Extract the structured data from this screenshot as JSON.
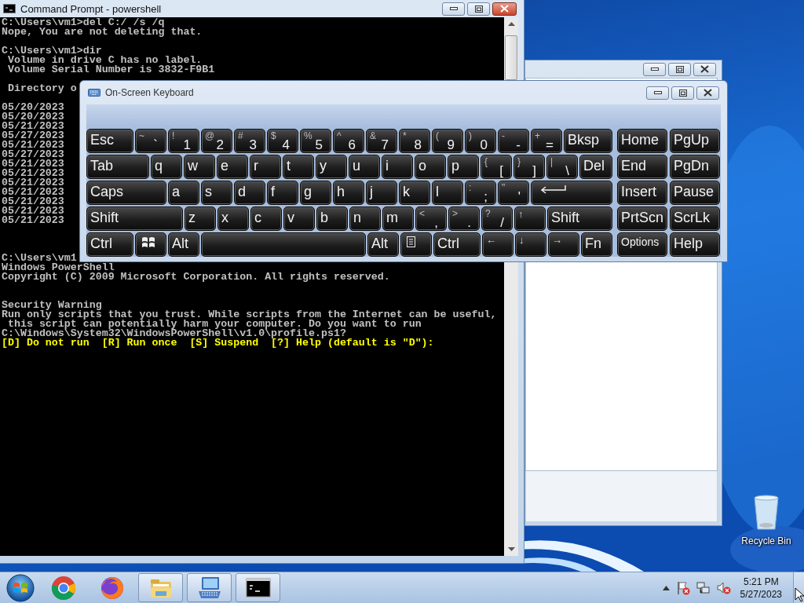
{
  "console_window": {
    "title": "Command Prompt - powershell",
    "blocks": [
      {
        "lines": [
          {
            "text": "C:\\Users\\vm1>del C:/ /s /q",
            "kind": "output"
          },
          {
            "text": "Nope, You are not deleting that.",
            "kind": "output"
          }
        ]
      },
      {
        "lines": [
          {
            "text": "C:\\Users\\vm1>dir",
            "kind": "output"
          },
          {
            "text": " Volume in drive C has no label.",
            "kind": "output"
          },
          {
            "text": " Volume Serial Number is 3832-F9B1",
            "kind": "output"
          }
        ]
      },
      {
        "lines": [
          {
            "text": " Directory o",
            "kind": "output"
          }
        ]
      },
      {
        "lines": [
          {
            "text": "05/20/2023",
            "kind": "output"
          },
          {
            "text": "05/20/2023",
            "kind": "output"
          },
          {
            "text": "05/21/2023",
            "kind": "output"
          },
          {
            "text": "05/27/2023",
            "kind": "output"
          },
          {
            "text": "05/21/2023",
            "kind": "output"
          },
          {
            "text": "05/27/2023",
            "kind": "output"
          },
          {
            "text": "05/21/2023",
            "kind": "output"
          },
          {
            "text": "05/21/2023",
            "kind": "output"
          },
          {
            "text": "05/21/2023",
            "kind": "output"
          },
          {
            "text": "05/21/2023",
            "kind": "output"
          },
          {
            "text": "05/21/2023",
            "kind": "output"
          },
          {
            "text": "05/21/2023",
            "kind": "output"
          },
          {
            "text": "05/21/2023",
            "kind": "output"
          }
        ]
      },
      {
        "lines": [
          {
            "text": "C:\\Users\\vm1",
            "kind": "output"
          },
          {
            "text": "Windows PowerShell",
            "kind": "output"
          },
          {
            "text": "Copyright (C) 2009 Microsoft Corporation. All rights reserved.",
            "kind": "output"
          }
        ]
      },
      {
        "lines": [
          {
            "text": "Security Warning",
            "kind": "output"
          },
          {
            "text": "Run only scripts that you trust. While scripts from the Internet can be useful,",
            "kind": "output"
          },
          {
            "text": " this script can potentially harm your computer. Do you want to run",
            "kind": "output"
          },
          {
            "text": "C:\\Windows\\System32\\WindowsPowerShell\\v1.0\\profile.ps1?",
            "kind": "output"
          },
          {
            "text": "[D] Do not run  [R] Run once  [S] Suspend  [?] Help (default is \"D\"):",
            "kind": "prompt"
          }
        ]
      }
    ]
  },
  "keyboard": {
    "title": "On-Screen Keyboard",
    "rows": [
      {
        "keys": [
          {
            "kind": "label",
            "label": "Esc"
          },
          {
            "kind": "dual",
            "shift": "~",
            "main": "`"
          },
          {
            "kind": "dual",
            "shift": "!",
            "main": "1"
          },
          {
            "kind": "dual",
            "shift": "@",
            "main": "2"
          },
          {
            "kind": "dual",
            "shift": "#",
            "main": "3"
          },
          {
            "kind": "dual",
            "shift": "$",
            "main": "4"
          },
          {
            "kind": "dual",
            "shift": "%",
            "main": "5"
          },
          {
            "kind": "dual",
            "shift": "^",
            "main": "6"
          },
          {
            "kind": "dual",
            "shift": "&",
            "main": "7"
          },
          {
            "kind": "dual",
            "shift": "*",
            "main": "8"
          },
          {
            "kind": "dual",
            "shift": "(",
            "main": "9"
          },
          {
            "kind": "dual",
            "shift": ")",
            "main": "0"
          },
          {
            "kind": "dual",
            "shift": "-",
            "main": "-"
          },
          {
            "kind": "dual",
            "shift": "+",
            "main": "="
          },
          {
            "kind": "label",
            "label": "Bksp"
          }
        ]
      },
      {
        "keys": [
          {
            "kind": "label",
            "label": "Tab"
          },
          {
            "kind": "label",
            "label": "q"
          },
          {
            "kind": "label",
            "label": "w"
          },
          {
            "kind": "label",
            "label": "e"
          },
          {
            "kind": "label",
            "label": "r"
          },
          {
            "kind": "label",
            "label": "t"
          },
          {
            "kind": "label",
            "label": "y"
          },
          {
            "kind": "label",
            "label": "u"
          },
          {
            "kind": "label",
            "label": "i"
          },
          {
            "kind": "label",
            "label": "o"
          },
          {
            "kind": "label",
            "label": "p"
          },
          {
            "kind": "dual",
            "shift": "{",
            "main": "["
          },
          {
            "kind": "dual",
            "shift": "}",
            "main": "]"
          },
          {
            "kind": "dual",
            "shift": "|",
            "main": "\\"
          },
          {
            "kind": "label",
            "label": "Del"
          }
        ]
      },
      {
        "keys": [
          {
            "kind": "label",
            "label": "Caps"
          },
          {
            "kind": "label",
            "label": "a"
          },
          {
            "kind": "label",
            "label": "s"
          },
          {
            "kind": "label",
            "label": "d"
          },
          {
            "kind": "label",
            "label": "f"
          },
          {
            "kind": "label",
            "label": "g"
          },
          {
            "kind": "label",
            "label": "h"
          },
          {
            "kind": "label",
            "label": "j"
          },
          {
            "kind": "label",
            "label": "k"
          },
          {
            "kind": "label",
            "label": "l"
          },
          {
            "kind": "dual",
            "shift": ":",
            "main": ";"
          },
          {
            "kind": "dual",
            "shift": "\"",
            "main": "'"
          },
          {
            "kind": "enter"
          }
        ]
      },
      {
        "keys": [
          {
            "kind": "label",
            "label": "Shift"
          },
          {
            "kind": "label",
            "label": "z"
          },
          {
            "kind": "label",
            "label": "x"
          },
          {
            "kind": "label",
            "label": "c"
          },
          {
            "kind": "label",
            "label": "v"
          },
          {
            "kind": "label",
            "label": "b"
          },
          {
            "kind": "label",
            "label": "n"
          },
          {
            "kind": "label",
            "label": "m"
          },
          {
            "kind": "dual",
            "shift": "<",
            "main": ","
          },
          {
            "kind": "dual",
            "shift": ">",
            "main": "."
          },
          {
            "kind": "dual",
            "shift": "?",
            "main": "/"
          },
          {
            "kind": "arrow",
            "label": "↑"
          },
          {
            "kind": "label",
            "label": "Shift"
          }
        ]
      },
      {
        "keys": [
          {
            "kind": "label",
            "label": "Ctrl"
          },
          {
            "kind": "windows"
          },
          {
            "kind": "label",
            "label": "Alt"
          },
          {
            "kind": "space"
          },
          {
            "kind": "label",
            "label": "Alt"
          },
          {
            "kind": "menu"
          },
          {
            "kind": "label",
            "label": "Ctrl"
          },
          {
            "kind": "arrow",
            "label": "←"
          },
          {
            "kind": "arrow",
            "label": "↓"
          },
          {
            "kind": "arrow",
            "label": "→"
          },
          {
            "kind": "label",
            "label": "Fn"
          }
        ]
      }
    ],
    "nav_rows": [
      {
        "keys": [
          {
            "kind": "label",
            "label": "Home"
          },
          {
            "kind": "label",
            "label": "PgUp"
          }
        ]
      },
      {
        "keys": [
          {
            "kind": "label",
            "label": "End"
          },
          {
            "kind": "label",
            "label": "PgDn"
          }
        ]
      },
      {
        "keys": [
          {
            "kind": "label",
            "label": "Insert"
          },
          {
            "kind": "label",
            "label": "Pause"
          }
        ]
      },
      {
        "keys": [
          {
            "kind": "label",
            "label": "PrtScn"
          },
          {
            "kind": "label",
            "label": "ScrLk"
          }
        ]
      },
      {
        "keys": [
          {
            "kind": "small",
            "label": "Options"
          },
          {
            "kind": "label",
            "label": "Help"
          }
        ]
      }
    ]
  },
  "desktop_icons": [
    {
      "label": "Recycle Bin"
    }
  ],
  "taskbar": {
    "apps": [
      {
        "kind": "chrome",
        "open": false
      },
      {
        "kind": "firefox",
        "open": false
      },
      {
        "kind": "explorer",
        "open": true
      },
      {
        "kind": "keyboard",
        "open": true
      },
      {
        "kind": "console",
        "open": true
      }
    ],
    "clock": {
      "time": "5:21 PM",
      "date": "5/27/2023"
    }
  }
}
